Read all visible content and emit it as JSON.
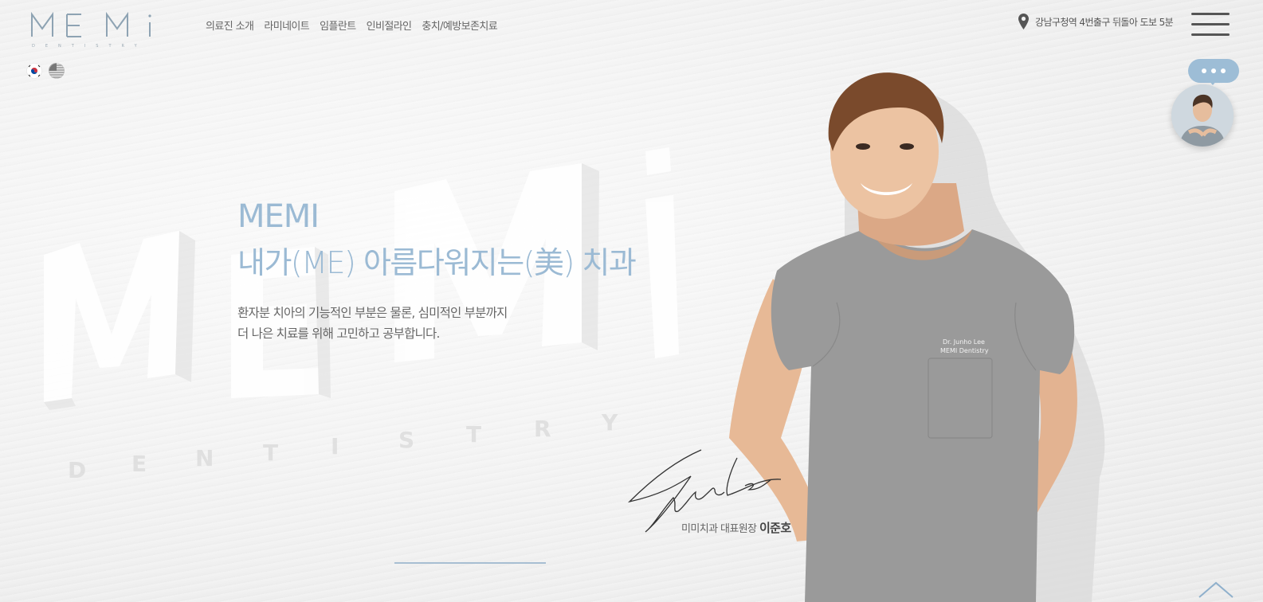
{
  "brand": {
    "logo_text": "MEMi",
    "logo_sub": "DENTISTRY"
  },
  "nav": {
    "items": [
      {
        "label": "의료진 소개"
      },
      {
        "label": "라미네이트"
      },
      {
        "label": "임플란트"
      },
      {
        "label": "인비절라인"
      },
      {
        "label": "충치/예방보존치료"
      }
    ]
  },
  "languages": [
    {
      "code": "ko",
      "icon": "korea-flag-icon"
    },
    {
      "code": "en",
      "icon": "usa-flag-icon"
    }
  ],
  "address": {
    "text": "강남구청역 4번출구 뒤돌아 도보 5분",
    "icon": "location-pin-icon"
  },
  "hero": {
    "title_line1": "MEMI",
    "title_line2": "내가(ME) 아름다워지는(美) 치과",
    "sub_line1": "환자분 치아의 기능적인 부분은 물론, 심미적인 부분까지",
    "sub_line2": "더 나은 치료를 위해 고민하고 공부합니다.",
    "accent_color": "#9bbad4"
  },
  "doctor": {
    "role": "미미치과 대표원장",
    "name": "이준호",
    "badge_line1": "Dr. Junho Lee",
    "badge_line2": "MEMI Dentistry"
  },
  "chat": {
    "icon": "chat-dots-icon"
  },
  "controls": {
    "menu_icon": "hamburger-menu-icon",
    "top_icon": "chevron-up-icon"
  }
}
